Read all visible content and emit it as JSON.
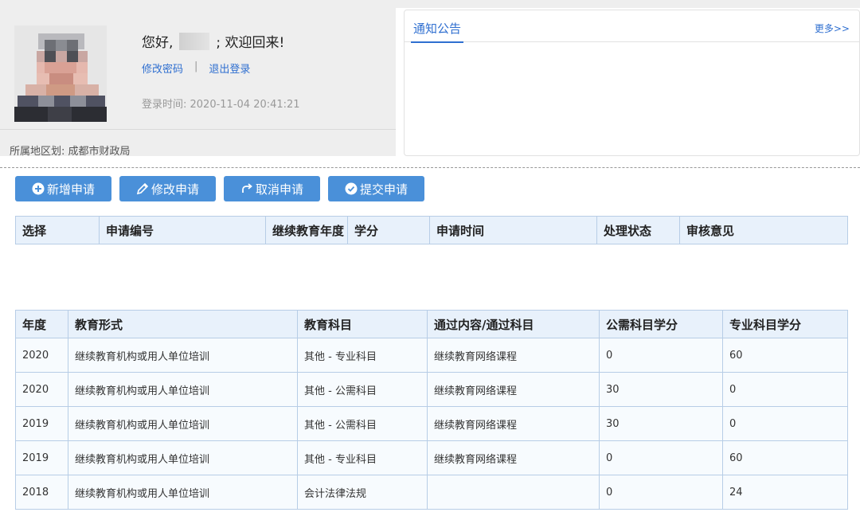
{
  "user_card": {
    "greeting_prefix": "您好,",
    "greeting_suffix": "; 欢迎回来!",
    "change_password": "修改密码",
    "separator": "|",
    "logout": "退出登录",
    "login_time": "登录时间: 2020-11-04 20:41:21",
    "region": "所属地区划: 成都市财政局"
  },
  "notice": {
    "tab_label": "通知公告",
    "more_label": "更多>>"
  },
  "toolbar": {
    "new_label": "新增申请",
    "edit_label": "修改申请",
    "cancel_label": "取消申请",
    "submit_label": "提交申请"
  },
  "application_table": {
    "headers": [
      "选择",
      "申请编号",
      "继续教育年度",
      "学分",
      "申请时间",
      "处理状态",
      "审核意见"
    ]
  },
  "records_table": {
    "headers": [
      "年度",
      "教育形式",
      "教育科目",
      "通过内容/通过科目",
      "公需科目学分",
      "专业科目学分"
    ],
    "rows": [
      [
        "2020",
        "继续教育机构或用人单位培训",
        "其他 - 专业科目",
        "继续教育网络课程",
        "0",
        "60"
      ],
      [
        "2020",
        "继续教育机构或用人单位培训",
        "其他 - 公需科目",
        "继续教育网络课程",
        "30",
        "0"
      ],
      [
        "2019",
        "继续教育机构或用人单位培训",
        "其他 - 公需科目",
        "继续教育网络课程",
        "30",
        "0"
      ],
      [
        "2019",
        "继续教育机构或用人单位培训",
        "其他 - 专业科目",
        "继续教育网络课程",
        "0",
        "60"
      ],
      [
        "2018",
        "继续教育机构或用人单位培训",
        "会计法律法规",
        "",
        "0",
        "24"
      ]
    ]
  },
  "colors": {
    "accent": "#4a90d9",
    "link": "#2f6fd0",
    "header_bg": "#e8f1fb",
    "border": "#b7cde6"
  }
}
